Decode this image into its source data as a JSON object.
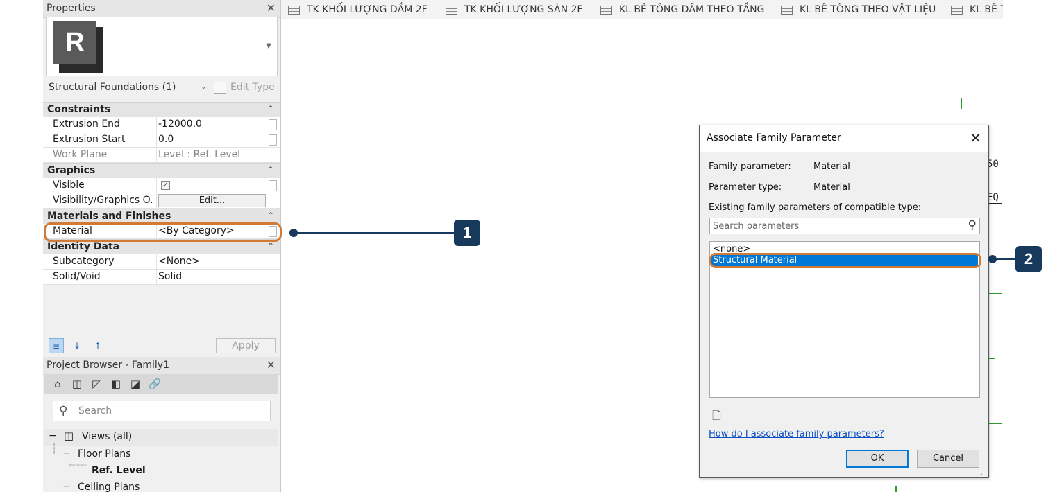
{
  "properties": {
    "title": "Properties",
    "close_glyph": "✕",
    "preview_logo": "R",
    "type_selector": "Structural Foundations (1)",
    "edit_type": "Edit Type",
    "groups": {
      "constraints": "Constraints",
      "graphics": "Graphics",
      "materials": "Materials and Finishes",
      "identity": "Identity Data"
    },
    "collapse_glyph": "⌃",
    "rows": {
      "extrusion_end": {
        "label": "Extrusion End",
        "value": "-12000.0"
      },
      "extrusion_start": {
        "label": "Extrusion Start",
        "value": "0.0"
      },
      "work_plane": {
        "label": "Work Plane",
        "value": "Level : Ref. Level"
      },
      "visible": {
        "label": "Visible",
        "checked": true
      },
      "visibility_graphics": {
        "label": "Visibility/Graphics O...",
        "button": "Edit..."
      },
      "material": {
        "label": "Material",
        "value": "<By Category>"
      },
      "subcategory": {
        "label": "Subcategory",
        "value": "<None>"
      },
      "solid_void": {
        "label": "Solid/Void",
        "value": "Solid"
      }
    },
    "apply": "Apply"
  },
  "project_browser": {
    "title": "Project Browser - Family1",
    "close_glyph": "✕",
    "search_placeholder": "Search",
    "tree": {
      "views": "Views (all)",
      "floor_plans": "Floor Plans",
      "ref_level": "Ref. Level",
      "ceiling_plans": "Ceiling Plans"
    }
  },
  "tabs": [
    {
      "label": "TK KHỐI LƯỢNG DẦM 2F"
    },
    {
      "label": "TK KHỐI LƯỢNG SÀN 2F"
    },
    {
      "label": "KL BÊ TÔNG DẦM THEO TẦNG"
    },
    {
      "label": "KL BÊ TÔNG THEO VẬT LIỆU"
    },
    {
      "label": "KL BÊ TÔ"
    }
  ],
  "canvas": {
    "cut_labels": [
      "50",
      "EQ"
    ]
  },
  "callouts": [
    "1",
    "2"
  ],
  "dialog": {
    "title": "Associate Family Parameter",
    "close_glyph": "✕",
    "family_parameter_label": "Family parameter:",
    "family_parameter_value": "Material",
    "parameter_type_label": "Parameter type:",
    "parameter_type_value": "Material",
    "existing_label": "Existing family parameters of compatible type:",
    "search_placeholder": "Search parameters",
    "items": [
      "<none>",
      "Structural Material"
    ],
    "selected_index": 1,
    "help_link": "How do I associate family parameters?",
    "ok": "OK",
    "cancel": "Cancel"
  },
  "colors": {
    "accent_highlight": "#d17a35",
    "callout": "#17395c",
    "selection": "#0078d7",
    "link": "#0a4fc4",
    "grid_line": "#2e9a2e"
  },
  "icons": [
    "close-icon",
    "dropdown-caret-icon",
    "edit-type-icon",
    "collapse-icon",
    "checkbox-icon",
    "sort-categorize-icon",
    "sort-ascending-icon",
    "sort-descending-icon",
    "home-icon",
    "search-icon",
    "new-parameter-icon",
    "schedule-tab-icon",
    "link-icon"
  ]
}
